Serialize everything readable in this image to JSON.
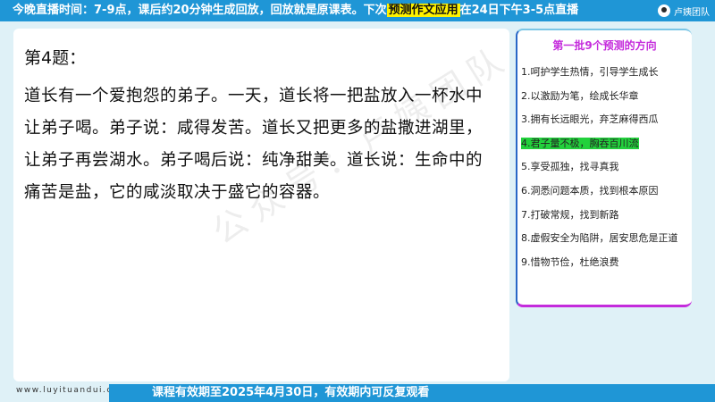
{
  "banner": {
    "text_before": "今晚直播时间：7-9点，课后约20分钟生成回放，回放就是原课表。下次",
    "highlight": "预测作文应用",
    "text_after": "在24日下午3-5点直播",
    "brand": "卢姨团队"
  },
  "question": {
    "title": "第4题：",
    "body": "道长有一个爱抱怨的弟子。一天，道长将一把盐放入一杯水中让弟子喝。弟子说：咸得发苦。道长又把更多的盐撒进湖里，让弟子再尝湖水。弟子喝后说：纯净甜美。道长说：生命中的痛苦是盐，它的咸淡取决于盛它的容器。"
  },
  "watermark": "公众号：卢姨团队",
  "panel": {
    "title": "第一批9个预测的方向",
    "items": [
      {
        "label": "1.呵护学生热情，引导学生成长",
        "active": false
      },
      {
        "label": "2.以激励为笔，绘成长华章",
        "active": false
      },
      {
        "label": "3.拥有长远眼光，弃芝麻得西瓜",
        "active": false
      },
      {
        "label": "4.君子量不极，胸吞百川流",
        "active": true
      },
      {
        "label": "5.享受孤独，找寻真我",
        "active": false
      },
      {
        "label": "6.洞悉问题本质，找到根本原因",
        "active": false
      },
      {
        "label": "7.打破常规，找到新路",
        "active": false
      },
      {
        "label": "8.虚假安全为陷阱，居安思危是正道",
        "active": false
      },
      {
        "label": "9.惜物节俭，杜绝浪费",
        "active": false
      }
    ]
  },
  "footer": {
    "url": "www.luyituandui.com",
    "notice": "课程有效期至2025年4月30日，有效期内可反复观看"
  },
  "colors": {
    "accent_blue": "#1f96d6",
    "highlight_yellow": "#fff200",
    "panel_magenta": "#c42bdc",
    "active_green": "#22d13c"
  }
}
